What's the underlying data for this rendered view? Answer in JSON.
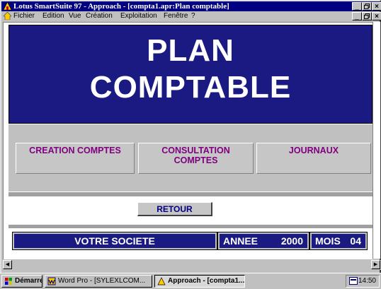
{
  "window": {
    "title": "Lotus SmartSuite 97  - Approach - [compta1.apr:Plan comptable]",
    "minimize": "_",
    "maximize": "\u0012",
    "close": "x"
  },
  "menu": {
    "items": [
      "Fichier",
      "Edition",
      "Vue",
      "Création",
      "Exploitation",
      "Fenêtre",
      "?"
    ],
    "underline": [
      "F",
      "E",
      "V",
      "C",
      "x",
      "n",
      "?"
    ]
  },
  "header": {
    "line1": "PLAN",
    "line2": "COMPTABLE"
  },
  "buttons": {
    "creation": "CREATION COMPTES",
    "consultation_l1": "CONSULTATION",
    "consultation_l2": "COMPTES",
    "journaux": "JOURNAUX",
    "retour": "RETOUR"
  },
  "footer": {
    "societe": "VOTRE SOCIETE",
    "annee_label": "ANNEE",
    "annee_value": "2000",
    "mois_label": "MOIS",
    "mois_value": "04"
  },
  "taskbar": {
    "start": "Démarrer",
    "tasks": [
      "Word Pro - [SYLEXLCOM...",
      "Approach - [compta1...."
    ],
    "clock": "14:50"
  },
  "colors": {
    "header_bg": "#1a1a82",
    "button_text": "#800080",
    "title_bar": "#000080"
  }
}
